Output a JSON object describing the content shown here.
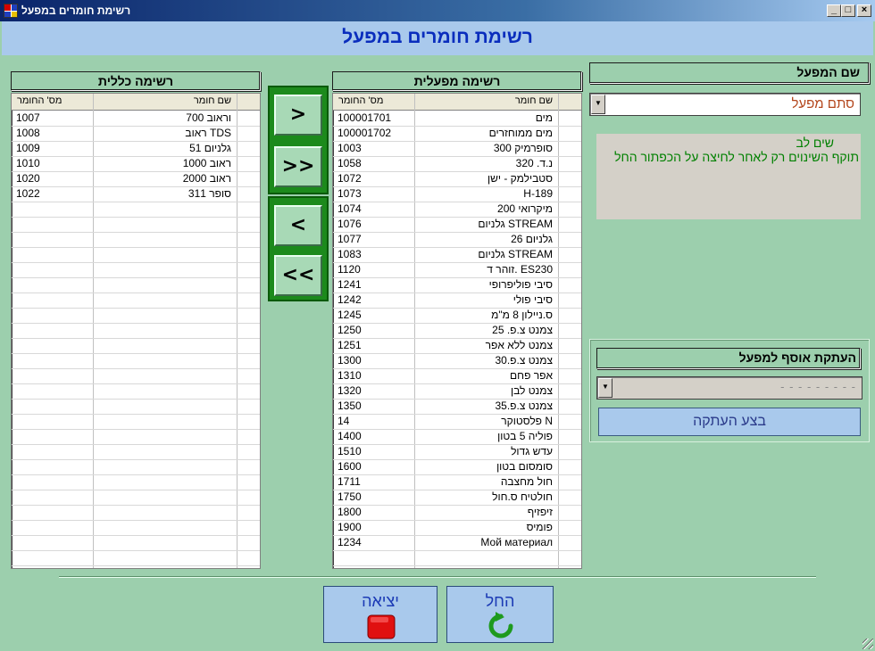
{
  "window": {
    "title": "רשימת חומרים במפעל",
    "controls": {
      "minimize": "_",
      "maximize": "□",
      "close": "×"
    }
  },
  "header": {
    "title": "רשימת חומרים במפעל"
  },
  "general_list": {
    "title": "רשימה כללית",
    "columns": {
      "name": "שם חומר",
      "number": "מס' החומר"
    },
    "rows": [
      {
        "name": "וראוב 700",
        "number": "1007"
      },
      {
        "name": "TDS ראוב",
        "number": "1008"
      },
      {
        "name": "גלניום 51",
        "number": "1009"
      },
      {
        "name": "ראוב 1000",
        "number": "1010"
      },
      {
        "name": "ראוב 2000",
        "number": "1020"
      },
      {
        "name": "סופר 311",
        "number": "1022"
      }
    ],
    "empty_rows": 24
  },
  "arrows": {
    "add": ">",
    "add_all": ">>",
    "remove": "<",
    "remove_all": "<<"
  },
  "factory_list": {
    "title": "רשימה מפעלית",
    "columns": {
      "name": "שם חומר",
      "number": "מס' החומר"
    },
    "rows": [
      {
        "name": "מים",
        "number": "100001701"
      },
      {
        "name": "מים ממוחזרים",
        "number": "100001702"
      },
      {
        "name": "סופרמיק 300",
        "number": "1003"
      },
      {
        "name": "נ.ד. 320",
        "number": "1058"
      },
      {
        "name": "סטבילמק - ישן",
        "number": "1072"
      },
      {
        "name": "189-H",
        "number": "1073"
      },
      {
        "name": "מיקרואי 200",
        "number": "1074"
      },
      {
        "name": "STREAM גלניום",
        "number": "1076"
      },
      {
        "name": "גלניום 26",
        "number": "1077"
      },
      {
        "name": "STREAM גלניום",
        "number": "1083"
      },
      {
        "name": "ES230 .זוהר ד",
        "number": "1120"
      },
      {
        "name": "סיבי פוליפרופי",
        "number": "1241"
      },
      {
        "name": "סיבי פולי",
        "number": "1242"
      },
      {
        "name": "ס.ניילון 8 מ\"מ",
        "number": "1245"
      },
      {
        "name": "צמנט צ.פ. 25",
        "number": "1250"
      },
      {
        "name": "צמנט ללא אפר",
        "number": "1251"
      },
      {
        "name": "צמנט צ.פ.30",
        "number": "1300"
      },
      {
        "name": "אפר פחם",
        "number": "1310"
      },
      {
        "name": "צמנט לבן",
        "number": "1320"
      },
      {
        "name": "צמנט צ.פ.35",
        "number": "1350"
      },
      {
        "name": "N פלסטוקר",
        "number": "14"
      },
      {
        "name": "פוליה 5 בטון",
        "number": "1400"
      },
      {
        "name": "עדש גדול",
        "number": "1510"
      },
      {
        "name": "סומסום בטון",
        "number": "1600"
      },
      {
        "name": "חול מחצבה",
        "number": "1711"
      },
      {
        "name": "חולטיח ס.חול",
        "number": "1750"
      },
      {
        "name": "זיפזיף",
        "number": "1800"
      },
      {
        "name": "פומיס",
        "number": "1900"
      },
      {
        "name": "Мой материал",
        "number": "1234"
      }
    ],
    "empty_rows": 1
  },
  "factory_select": {
    "label": "שם המפעל",
    "value": "סתם מפעל"
  },
  "notice": {
    "title": "שים לב",
    "text": "תוקף השינוים רק לאחר לחיצה על הכפתור החל"
  },
  "copy_section": {
    "label": "העתקת אוסף למפעל",
    "combo_value": "- - - - - - - - -",
    "button": "בצע העתקה"
  },
  "footer": {
    "exit_label": "יציאה",
    "apply_label": "החל"
  },
  "colors": {
    "window_bg": "#9ccfad",
    "header_bg": "#a9c9ec",
    "header_text": "#0a2dbd",
    "notice_text": "#008000",
    "factory_value": "#b3461c",
    "arrow_group": "#1c8a1c"
  }
}
